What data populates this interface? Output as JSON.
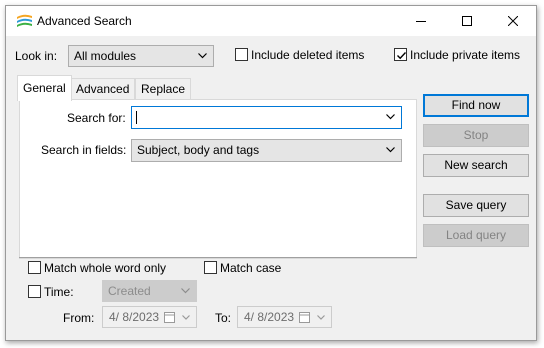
{
  "window": {
    "title": "Advanced Search"
  },
  "top": {
    "look_in_label": "Look in:",
    "look_in_value": "All modules",
    "include_deleted_label": "Include deleted items",
    "include_deleted_checked": false,
    "include_private_label": "Include private items",
    "include_private_checked": true
  },
  "tabs": [
    {
      "label": "General",
      "active": true
    },
    {
      "label": "Advanced",
      "active": false
    },
    {
      "label": "Replace",
      "active": false
    }
  ],
  "general": {
    "search_for_label": "Search for:",
    "search_for_value": "",
    "search_in_fields_label": "Search in fields:",
    "search_in_fields_value": "Subject, body and tags"
  },
  "options": {
    "match_whole_word_label": "Match whole word only",
    "match_whole_word_checked": false,
    "match_case_label": "Match case",
    "match_case_checked": false,
    "time_label": "Time:",
    "time_checked": false,
    "time_value": "Created",
    "from_label": "From:",
    "from_value": "4/  8/2023",
    "to_label": "To:",
    "to_value": "4/  8/2023"
  },
  "buttons": {
    "find_now": "Find now",
    "stop": "Stop",
    "new_search": "New search",
    "save_query": "Save query",
    "load_query": "Load query"
  },
  "colors": {
    "accent": "#0078d7",
    "window_bg": "#f0f0f0",
    "disabled_text": "#838383"
  }
}
